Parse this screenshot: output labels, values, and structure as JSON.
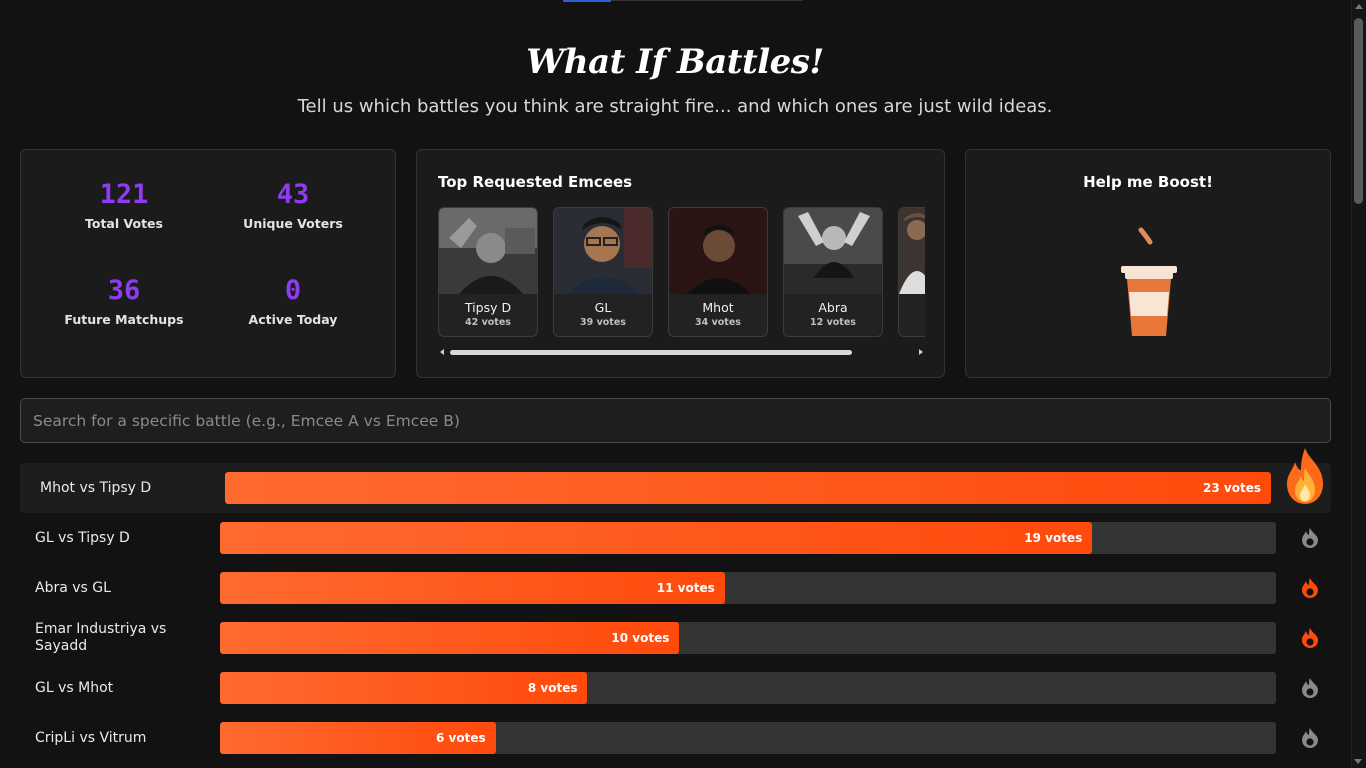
{
  "page": {
    "title": "What If Battles!",
    "subtitle": "Tell us which battles you think are straight fire... and which ones are just wild ideas."
  },
  "stats": [
    {
      "value": "121",
      "label": "Total Votes"
    },
    {
      "value": "43",
      "label": "Unique Voters"
    },
    {
      "value": "36",
      "label": "Future Matchups"
    },
    {
      "value": "0",
      "label": "Active Today"
    }
  ],
  "emcees": {
    "title": "Top Requested Emcees",
    "items": [
      {
        "name": "Tipsy D",
        "votes": "42 votes"
      },
      {
        "name": "GL",
        "votes": "39 votes"
      },
      {
        "name": "Mhot",
        "votes": "34 votes"
      },
      {
        "name": "Abra",
        "votes": "12 votes"
      }
    ]
  },
  "boost": {
    "title": "Help me Boost!",
    "icon": "coffee-cup-icon"
  },
  "search": {
    "placeholder": "Search for a specific battle (e.g., Emcee A vs Emcee B)",
    "value": ""
  },
  "colors": {
    "accent": "#8e3cf0",
    "bar": "#ff5a1f",
    "hot": "#ff4a0c",
    "inactive_icon": "#8a8a8a"
  },
  "battles": [
    {
      "name": "Mhot vs Tipsy D",
      "votes": 23,
      "label": "23 votes",
      "fill": 1.0,
      "hot": true
    },
    {
      "name": "GL vs Tipsy D",
      "votes": 19,
      "label": "19 votes",
      "fill": 0.826,
      "hot": false
    },
    {
      "name": "Abra vs GL",
      "votes": 11,
      "label": "11 votes",
      "fill": 0.478,
      "hot": true
    },
    {
      "name": "Emar Industriya vs Sayadd",
      "votes": 10,
      "label": "10 votes",
      "fill": 0.435,
      "hot": true
    },
    {
      "name": "GL vs Mhot",
      "votes": 8,
      "label": "8 votes",
      "fill": 0.348,
      "hot": false
    },
    {
      "name": "CripLi vs Vitrum",
      "votes": 6,
      "label": "6 votes",
      "fill": 0.261,
      "hot": false
    }
  ]
}
